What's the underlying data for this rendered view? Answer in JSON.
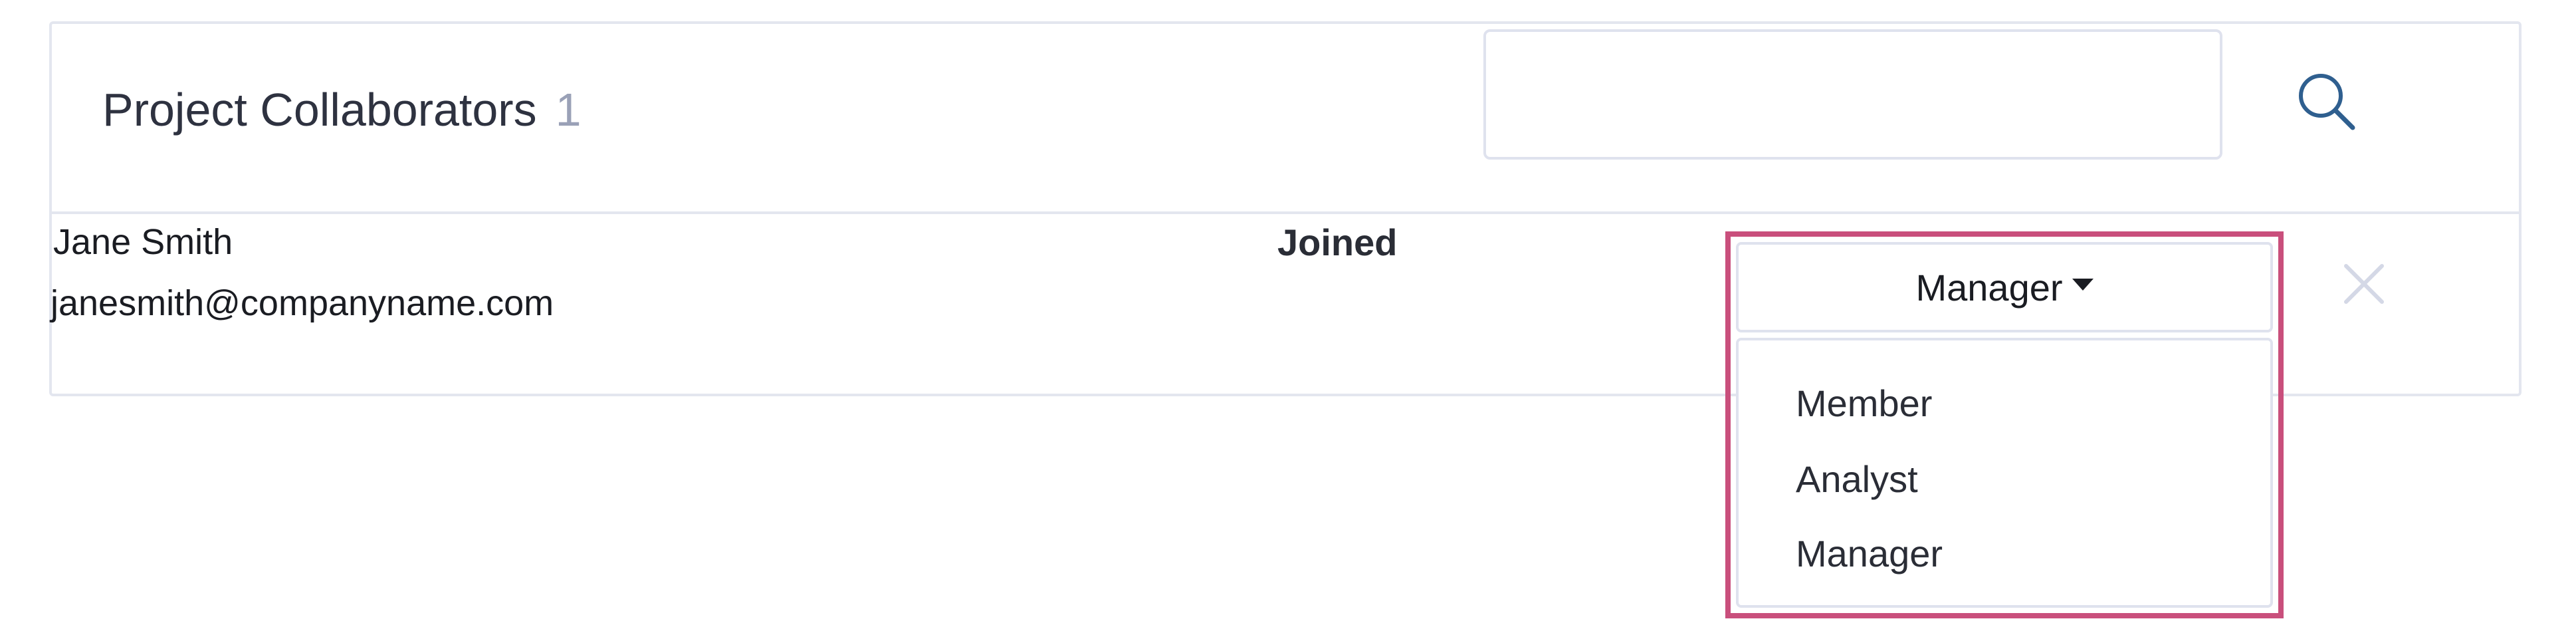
{
  "panel": {
    "title": "Project Collaborators",
    "count": "1"
  },
  "search": {
    "value": "",
    "placeholder": ""
  },
  "collaborators": [
    {
      "name": "Jane Smith",
      "email": "janesmith@companyname.com",
      "status": "Joined",
      "role": "Manager"
    }
  ],
  "role_dropdown": {
    "options": [
      "Member",
      "Analyst",
      "Manager"
    ],
    "expanded": true
  },
  "icons": {
    "search": "search-icon",
    "caret": "caret-down-icon",
    "remove": "close-icon"
  },
  "colors": {
    "highlight": "#c94f7c",
    "icon_blue": "#2f5f8f",
    "count_gray": "#9aa1b7",
    "border": "#e3e6ef"
  }
}
